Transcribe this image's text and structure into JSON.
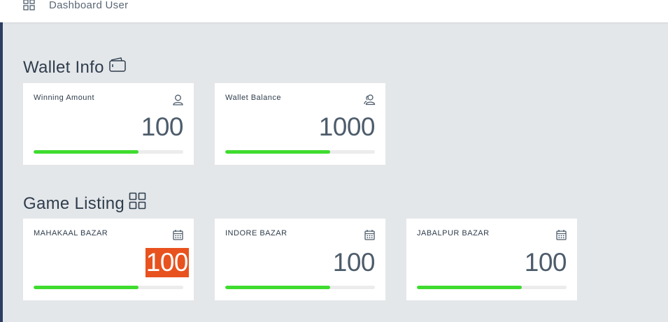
{
  "header": {
    "title": "Dashboard User",
    "icon": "grid-icon"
  },
  "wallet": {
    "title": "Wallet Info",
    "icon": "wallet-icon",
    "cards": [
      {
        "label": "Winning Amount",
        "value": "100",
        "icon": "user-icon",
        "progress": 0.7
      },
      {
        "label": "Wallet Balance",
        "value": "1000",
        "icon": "users-icon",
        "progress": 0.7
      }
    ]
  },
  "games": {
    "title": "Game Listing",
    "icon": "grid-icon",
    "cards": [
      {
        "label": "MAHAKAAL BAZAR",
        "value": "100",
        "icon": "calendar-icon",
        "progress": 0.7,
        "highlighted": true
      },
      {
        "label": "INDORE BAZAR",
        "value": "100",
        "icon": "calendar-icon",
        "progress": 0.7
      },
      {
        "label": "JABALPUR BAZAR",
        "value": "100",
        "icon": "calendar-icon",
        "progress": 0.7
      }
    ]
  },
  "colors": {
    "progress_fill": "#3fdc2f",
    "highlight": "#e8521e",
    "sidebar_edge": "#2c3e63"
  }
}
